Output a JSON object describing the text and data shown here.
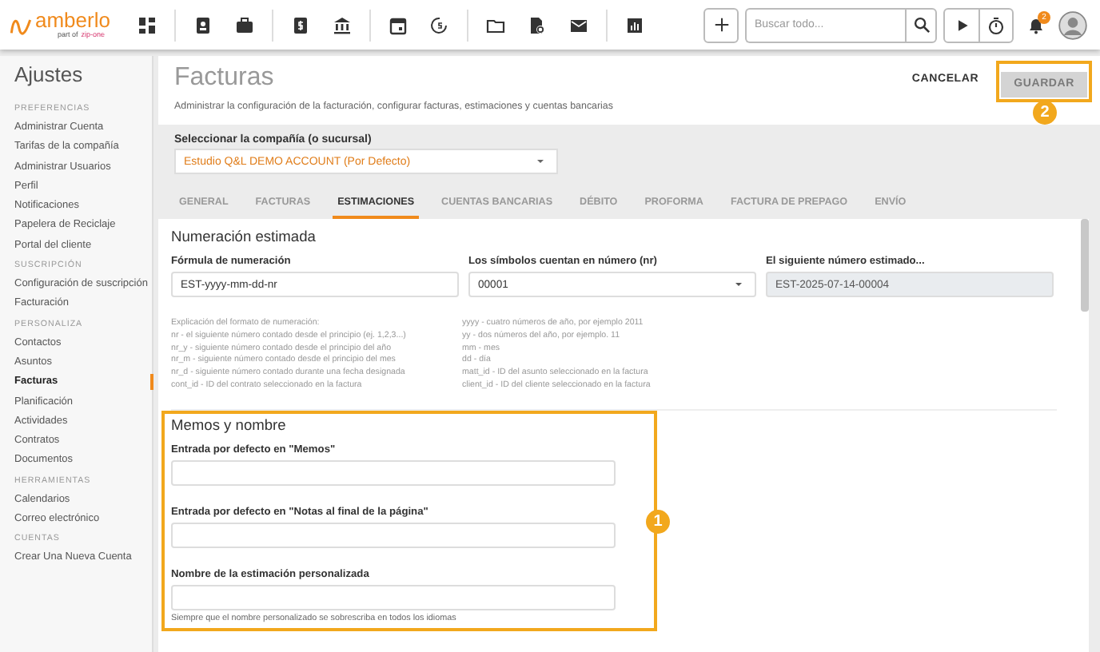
{
  "app": {
    "logo": "amberlo",
    "tagline": "part of",
    "partner": "zip-one"
  },
  "topbar": {
    "search": {
      "placeholder": "Buscar todo..."
    },
    "notifications": {
      "badge": "2"
    }
  },
  "sidebar": {
    "title": "Ajustes",
    "sections": [
      {
        "heading": "PREFERENCIAS",
        "items": [
          {
            "label": "Administrar Cuenta",
            "selected": false
          },
          {
            "label": "Tarifas de la compañía",
            "selected": false
          },
          {
            "label": "Administrar Usuarios",
            "selected": false
          },
          {
            "label": "Perfil",
            "selected": false
          },
          {
            "label": "Notificaciones",
            "selected": false
          },
          {
            "label": "Papelera de Reciclaje",
            "selected": false
          },
          {
            "label": "Portal del cliente",
            "selected": false
          }
        ]
      },
      {
        "heading": "SUSCRIPCIÓN",
        "items": [
          {
            "label": "Configuración de suscripción",
            "selected": false
          },
          {
            "label": "Facturación",
            "selected": false
          }
        ]
      },
      {
        "heading": "PERSONALIZA",
        "items": [
          {
            "label": "Contactos",
            "selected": false
          },
          {
            "label": "Asuntos",
            "selected": false
          },
          {
            "label": "Facturas",
            "selected": true
          },
          {
            "label": "Planificación",
            "selected": false
          },
          {
            "label": "Actividades",
            "selected": false
          },
          {
            "label": "Contratos",
            "selected": false
          },
          {
            "label": "Documentos",
            "selected": false
          }
        ]
      },
      {
        "heading": "HERRAMIENTAS",
        "items": [
          {
            "label": "Calendarios",
            "selected": false
          },
          {
            "label": "Correo electrónico",
            "selected": false
          }
        ]
      },
      {
        "heading": "CUENTAS",
        "items": [
          {
            "label": "Crear Una Nueva Cuenta",
            "selected": false
          }
        ]
      }
    ]
  },
  "page": {
    "title": "Facturas",
    "subtitle": "Administrar la configuración de la facturación, configurar facturas, estimaciones y cuentas bancarias",
    "cancel": {
      "label": "CANCELAR"
    },
    "save": {
      "label": "GUARDAR",
      "disabled": true,
      "callout": "2"
    }
  },
  "company": {
    "label": "Seleccionar la compañía (o sucursal)",
    "value": "Estudio Q&L DEMO ACCOUNT (Por Defecto)"
  },
  "tabs": [
    {
      "label": "GENERAL",
      "selected": false
    },
    {
      "label": "FACTURAS",
      "selected": false
    },
    {
      "label": "ESTIMACIONES",
      "selected": true
    },
    {
      "label": "CUENTAS BANCARIAS",
      "selected": false
    },
    {
      "label": "DÉBITO",
      "selected": false
    },
    {
      "label": "PROFORMA",
      "selected": false
    },
    {
      "label": "FACTURA DE PREPAGO",
      "selected": false
    },
    {
      "label": "ENVÍO",
      "selected": false
    }
  ],
  "numbering": {
    "title": "Numeración estimada",
    "fields": [
      {
        "kind": "text",
        "label": "Fórmula de numeración",
        "value": "EST-yyyy-mm-dd-nr"
      },
      {
        "kind": "select",
        "label": "Los símbolos cuentan en número (nr)",
        "value": "00001"
      },
      {
        "kind": "readonly",
        "label": "El siguiente número estimado...",
        "value": "EST-2025-07-14-00004"
      }
    ],
    "help": [
      [
        "Explicación del formato de numeración:",
        "nr - el siguiente número contado desde el principio (ej. 1,2,3...)",
        "nr_y - siguiente número contado desde el principio del año",
        "nr_m - siguiente número contado desde el principio del mes",
        "nr_d - siguiente número contado durante una fecha designada",
        "cont_id - ID del contrato seleccionado en la factura"
      ],
      [
        "yyyy - cuatro números de año, por ejemplo 2011",
        "yy - dos números del año, por ejemplo. 11",
        "mm - mes",
        "dd - día",
        "matt_id - ID del asunto seleccionado en la factura",
        "client_id - ID del cliente seleccionado en la factura"
      ]
    ]
  },
  "memos": {
    "title": "Memos y nombre",
    "callout": "1",
    "fields": [
      {
        "label": "Entrada por defecto en \"Memos\""
      },
      {
        "label": "Entrada por defecto en \"Notas al final de la página\""
      },
      {
        "label": "Nombre de la estimación personalizada"
      }
    ],
    "note": "Siempre que el nombre personalizado se sobrescriba en todos los idiomas"
  }
}
